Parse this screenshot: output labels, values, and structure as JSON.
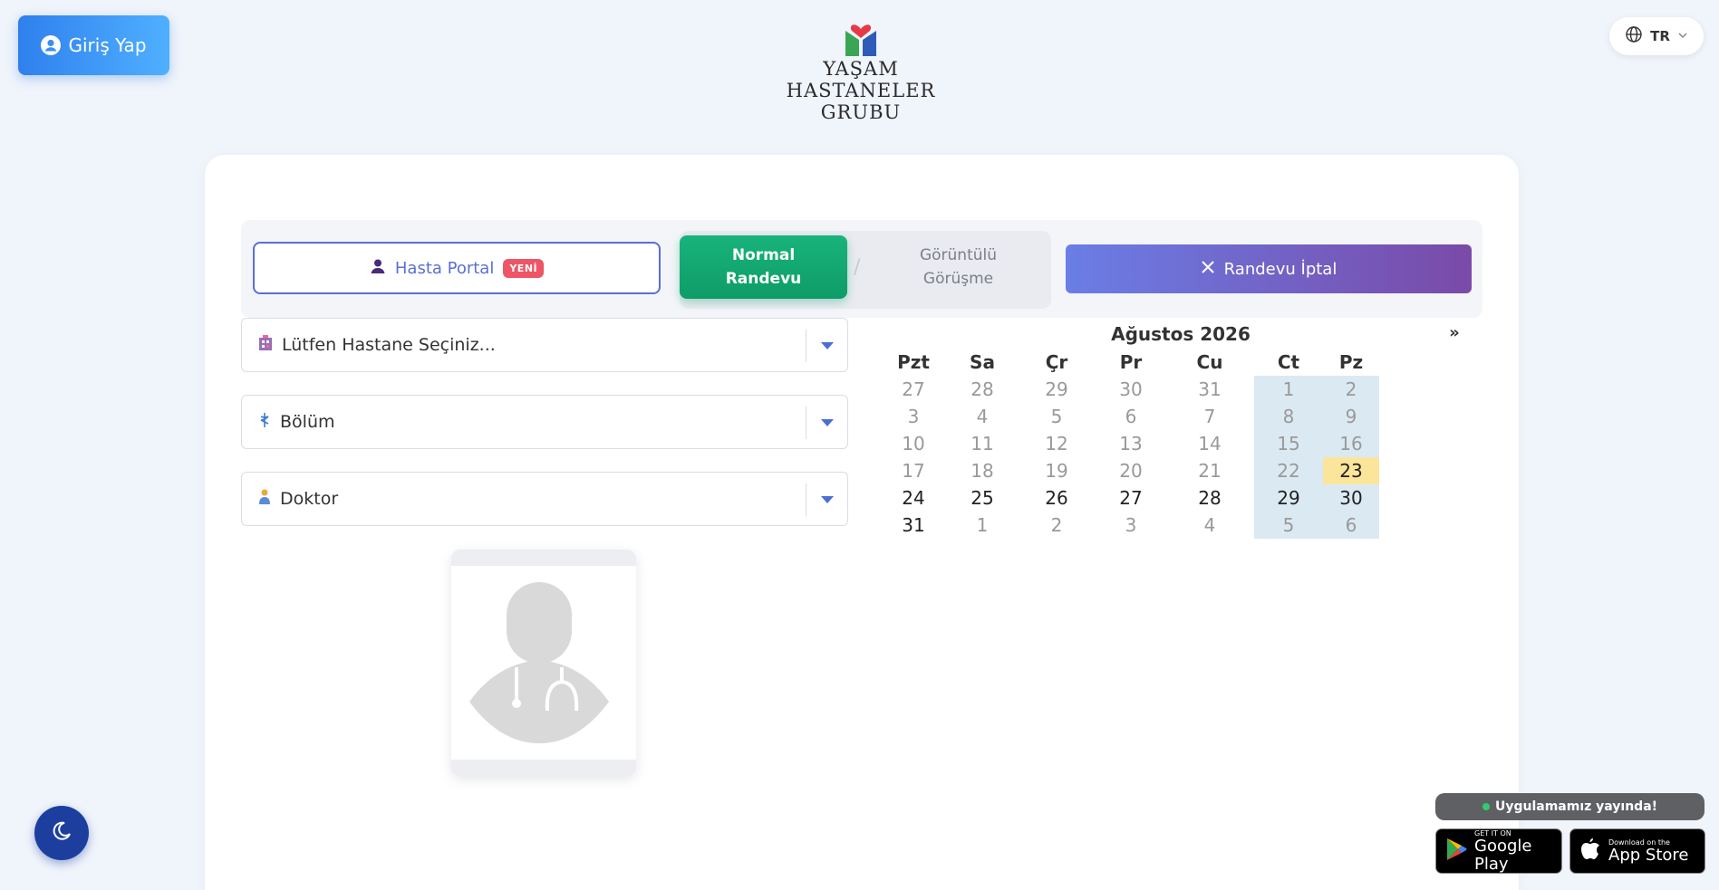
{
  "header": {
    "login_label": "Giriş Yap",
    "logo_line1": "YAŞAM",
    "logo_line2": "HASTANELER GRUBU",
    "language": "TR"
  },
  "tabs": {
    "portal_label": "Hasta Portal",
    "portal_badge": "YENİ",
    "normal_line1": "Normal",
    "normal_line2": "Randevu",
    "video_line1": "Görüntülü",
    "video_line2": "Görüşme",
    "cancel_label": "Randevu İptal"
  },
  "form": {
    "hospital_placeholder": "Lütfen Hastane Seçiniz...",
    "department_placeholder": "Bölüm",
    "doctor_placeholder": "Doktor"
  },
  "calendar": {
    "title": "Ağustos 2026",
    "next": "»",
    "weekdays": [
      "Pzt",
      "Sa",
      "Çr",
      "Pr",
      "Cu",
      "Ct",
      "Pz"
    ],
    "weeks": [
      [
        "27",
        "28",
        "29",
        "30",
        "31",
        "1",
        "2"
      ],
      [
        "3",
        "4",
        "5",
        "6",
        "7",
        "8",
        "9"
      ],
      [
        "10",
        "11",
        "12",
        "13",
        "14",
        "15",
        "16"
      ],
      [
        "17",
        "18",
        "19",
        "20",
        "21",
        "22",
        "23"
      ],
      [
        "24",
        "25",
        "26",
        "27",
        "28",
        "29",
        "30"
      ],
      [
        "31",
        "1",
        "2",
        "3",
        "4",
        "5",
        "6"
      ]
    ],
    "today": "23"
  },
  "promo": {
    "banner": "Uygulamamız yayında!",
    "google_small": "GET IT ON",
    "google_big": "Google Play",
    "apple_small": "Download on the",
    "apple_big": "App Store"
  },
  "colors": {
    "accent_green": "#0e9c68",
    "accent_purple": "#7a4aa8",
    "brand_blue": "#2f80ed",
    "weekend_bg": "#dbe9f3",
    "today_bg": "#fbe59a"
  }
}
